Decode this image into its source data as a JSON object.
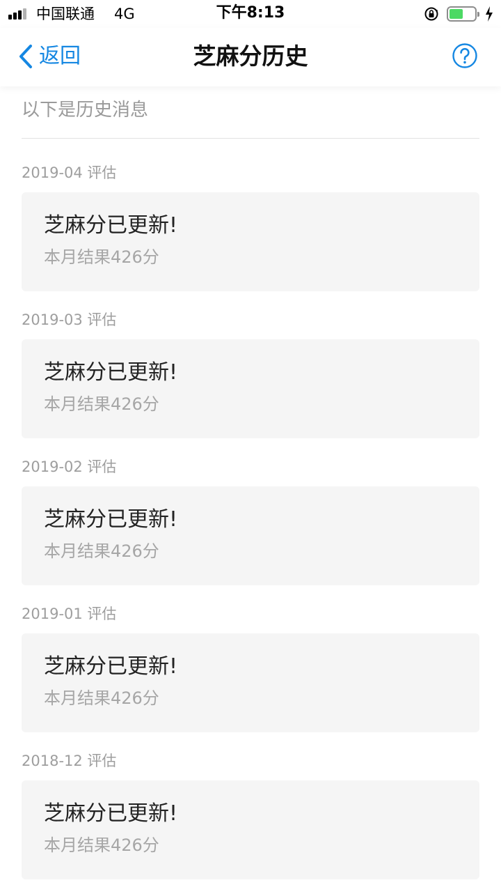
{
  "status_bar": {
    "carrier": "中国联通",
    "network": "4G",
    "time": "下午8:13",
    "battery_color": "#4cd964"
  },
  "nav": {
    "back_label": "返回",
    "title": "芝麻分历史",
    "accent_color": "#1587e2",
    "help_icon": "question-circle-icon"
  },
  "intro": "以下是历史消息",
  "history": [
    {
      "month": "2019-04 评估",
      "title": "芝麻分已更新!",
      "result": "本月结果426分"
    },
    {
      "month": "2019-03 评估",
      "title": "芝麻分已更新!",
      "result": "本月结果426分"
    },
    {
      "month": "2019-02 评估",
      "title": "芝麻分已更新!",
      "result": "本月结果426分"
    },
    {
      "month": "2019-01 评估",
      "title": "芝麻分已更新!",
      "result": "本月结果426分"
    },
    {
      "month": "2018-12 评估",
      "title": "芝麻分已更新!",
      "result": "本月结果426分"
    }
  ]
}
